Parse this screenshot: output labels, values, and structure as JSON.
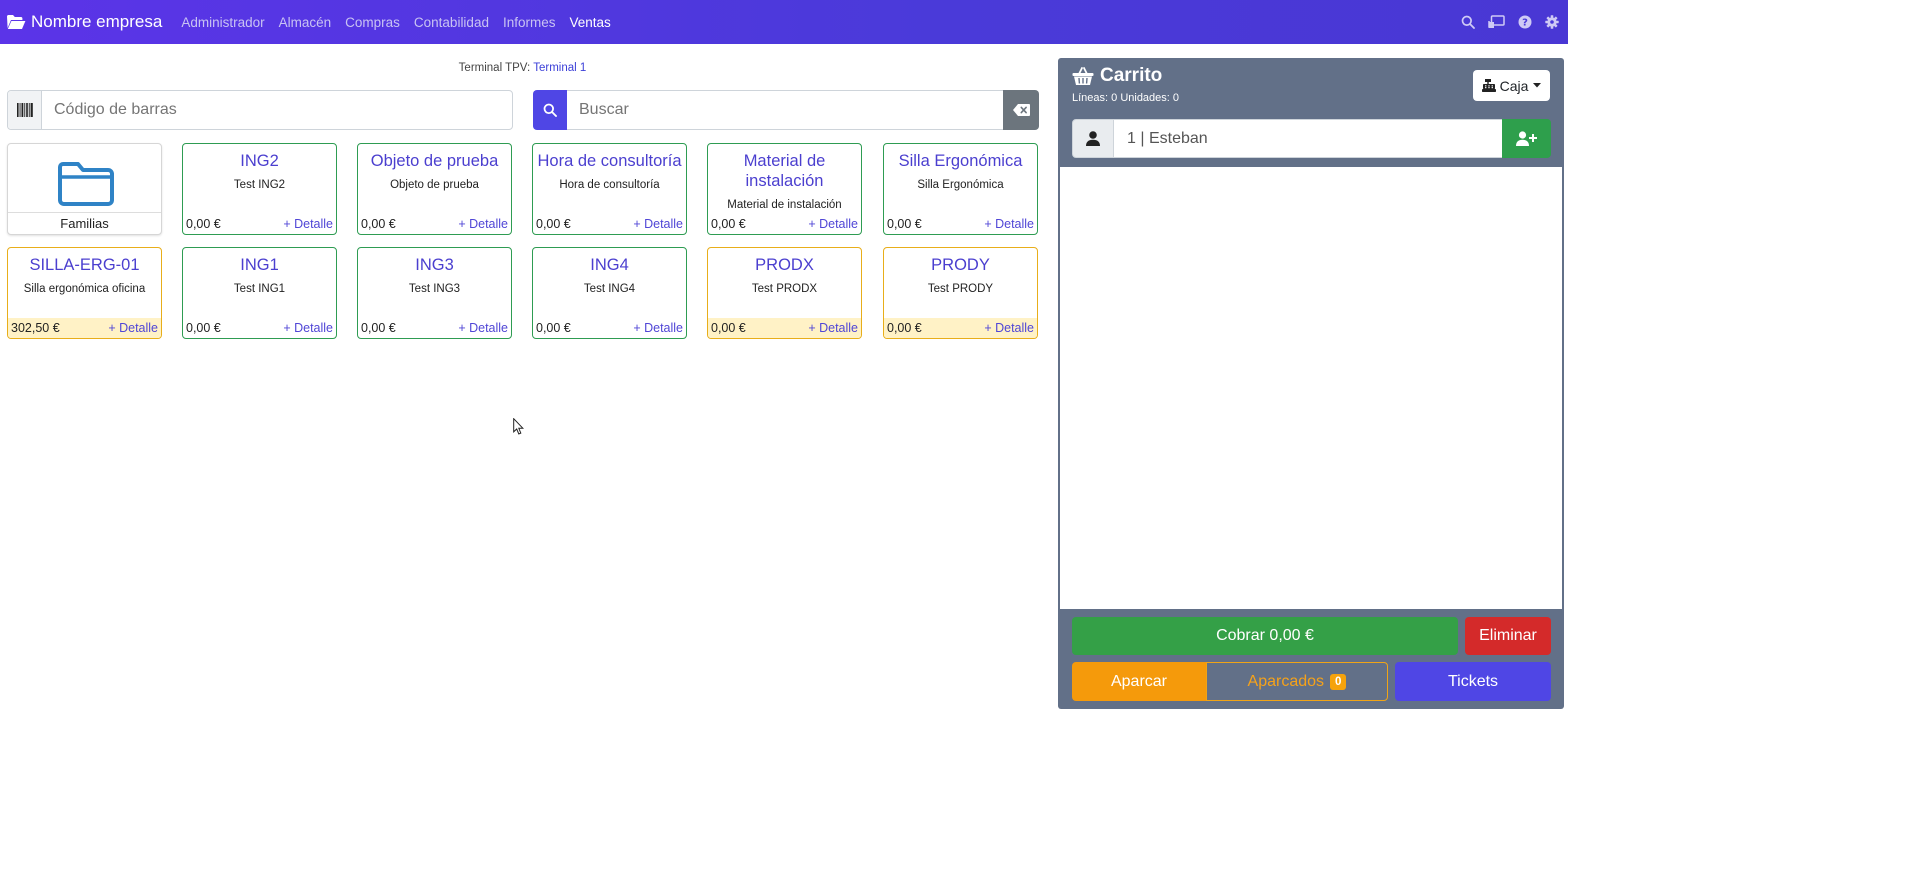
{
  "navbar": {
    "brand": "Nombre empresa",
    "links": [
      "Administrador",
      "Almacén",
      "Compras",
      "Contabilidad",
      "Informes",
      "Ventas"
    ],
    "active": "Ventas",
    "icons": [
      "search-icon",
      "screen-share-icon",
      "help-icon",
      "settings-icon"
    ]
  },
  "terminal": {
    "label": "Terminal TPV:",
    "name": "Terminal 1"
  },
  "barcode": {
    "placeholder": "Código de barras"
  },
  "search": {
    "placeholder": "Buscar"
  },
  "families": {
    "label": "Familias"
  },
  "products": [
    {
      "title": "ING2",
      "desc": "Test ING2",
      "price": "0,00 €",
      "detail": "+ Detalle",
      "status": "ok"
    },
    {
      "title": "Objeto de prueba",
      "desc": "Objeto de prueba",
      "price": "0,00 €",
      "detail": "+ Detalle",
      "status": "ok"
    },
    {
      "title": "Hora de consultoría",
      "desc": "Hora de consultoría",
      "price": "0,00 €",
      "detail": "+ Detalle",
      "status": "ok"
    },
    {
      "title": "Material de instalación",
      "desc": "Material de instalación",
      "price": "0,00 €",
      "detail": "+ Detalle",
      "status": "ok"
    },
    {
      "title": "Silla Ergonómica",
      "desc": "Silla Ergonómica",
      "price": "0,00 €",
      "detail": "+ Detalle",
      "status": "ok"
    },
    {
      "title": "SILLA-ERG-01",
      "desc": "Silla ergonómica oficina",
      "price": "302,50 €",
      "detail": "+ Detalle",
      "status": "warn"
    },
    {
      "title": "ING1",
      "desc": "Test ING1",
      "price": "0,00 €",
      "detail": "+ Detalle",
      "status": "ok"
    },
    {
      "title": "ING3",
      "desc": "Test ING3",
      "price": "0,00 €",
      "detail": "+ Detalle",
      "status": "ok"
    },
    {
      "title": "ING4",
      "desc": "Test ING4",
      "price": "0,00 €",
      "detail": "+ Detalle",
      "status": "ok"
    },
    {
      "title": "PRODX",
      "desc": "Test PRODX",
      "price": "0,00 €",
      "detail": "+ Detalle",
      "status": "warn"
    },
    {
      "title": "PRODY",
      "desc": "Test PRODY",
      "price": "0,00 €",
      "detail": "+ Detalle",
      "status": "warn"
    }
  ],
  "cart": {
    "title": "Carrito",
    "summary": "Líneas: 0 Unidades: 0",
    "caja_label": "Caja",
    "customer": "1 | Esteban",
    "cobrar_label": "Cobrar 0,00 €",
    "eliminar_label": "Eliminar",
    "aparcar_label": "Aparcar",
    "aparcados_label": "Aparcados",
    "aparcados_count": "0",
    "tickets_label": "Tickets"
  },
  "colors": {
    "navbar": "#4a3ad9",
    "primary": "#4f46e5",
    "success": "#34a047",
    "danger": "#d42a2a",
    "warning": "#f59a0b",
    "cart_panel": "#627088",
    "card_ok_border": "#2e9c52",
    "card_warn_border": "#e8ae1a"
  }
}
